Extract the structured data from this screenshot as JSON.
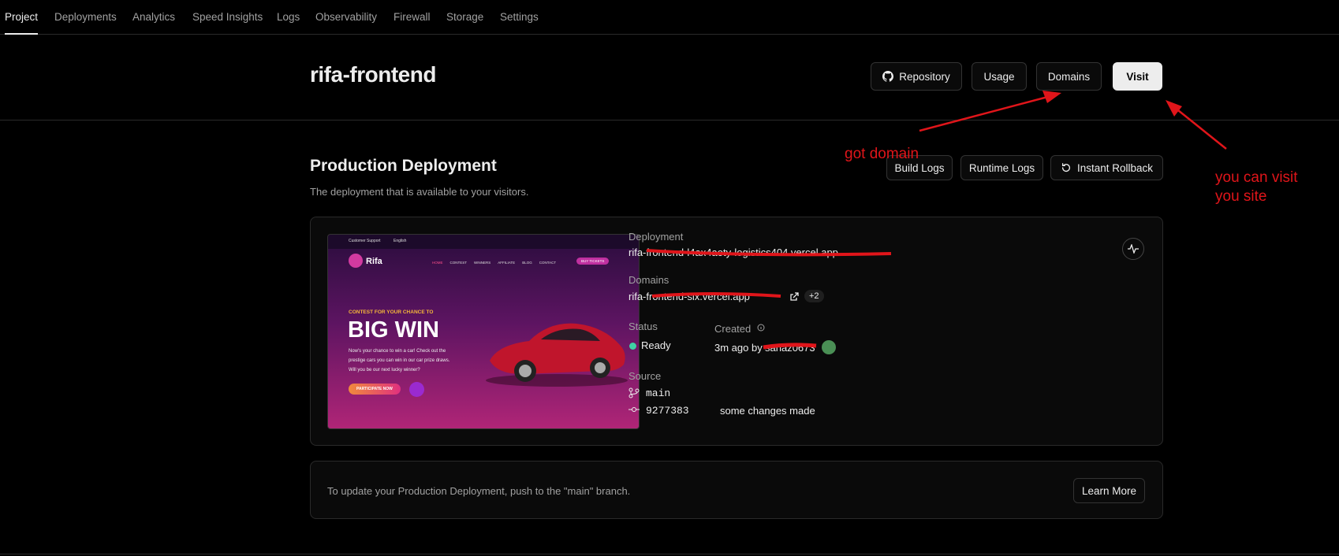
{
  "nav": {
    "tabs": [
      {
        "label": "Project",
        "active": true
      },
      {
        "label": "Deployments"
      },
      {
        "label": "Analytics"
      },
      {
        "label": "Speed Insights"
      },
      {
        "label": "Logs"
      },
      {
        "label": "Observability"
      },
      {
        "label": "Firewall"
      },
      {
        "label": "Storage"
      },
      {
        "label": "Settings"
      }
    ]
  },
  "header": {
    "title": "rifa-frontend",
    "repository_label": "Repository",
    "usage_label": "Usage",
    "domains_label": "Domains",
    "visit_label": "Visit"
  },
  "production": {
    "title": "Production Deployment",
    "subtitle": "The deployment that is available to your visitors.",
    "build_logs_label": "Build Logs",
    "runtime_logs_label": "Runtime Logs",
    "rollback_label": "Instant Rollback"
  },
  "deployment": {
    "deployment_label": "Deployment",
    "deployment_url": "rifa-frontend-l4ax4aoty-logistics404.vercel.app",
    "domains_label": "Domains",
    "domain_url": "rifa-frontend-six.vercel.app",
    "domains_extra": "+2",
    "status_label": "Status",
    "status_value": "Ready",
    "status_color": "#3fd2a4",
    "created_label": "Created",
    "created_value": "3m ago by",
    "created_user": "sanaz0673",
    "source_label": "Source",
    "branch": "main",
    "commit_hash": "9277383",
    "commit_message": "some changes made"
  },
  "preview_site": {
    "support": "Customer Support",
    "language": "English",
    "brand": "Rifa",
    "menu": [
      "HOME",
      "CONTEST",
      "WINNERS",
      "AFFILIATE",
      "BLOG",
      "CONTACT"
    ],
    "buy_label": "BUY TICKETS",
    "tagline": "CONTEST FOR YOUR CHANCE TO",
    "headline": "BIG WIN",
    "body_line1": "Now's your chance to win a car! Check out the",
    "body_line2": "prestige cars you can win in our car prize draws.",
    "body_line3": "Will you be our next lucky winner?",
    "cta": "PARTICIPATE NOW"
  },
  "update_card": {
    "text": "To update your Production Deployment, push to the \"main\" branch.",
    "learn_more_label": "Learn More"
  },
  "annotations": {
    "domain_note": "got domain",
    "visit_note_line1": "you can visit",
    "visit_note_line2": "you site",
    "color": "#e0151a"
  }
}
